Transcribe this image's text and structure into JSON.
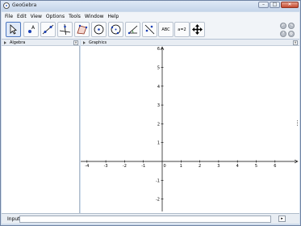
{
  "window": {
    "title": "GeoGebra",
    "minimize": "–",
    "maximize": "□",
    "close": "✕"
  },
  "menu": [
    "File",
    "Edit",
    "View",
    "Options",
    "Tools",
    "Window",
    "Help"
  ],
  "toolbar": {
    "tools": [
      {
        "name": "move-tool-button",
        "icon": "arrow-cursor-icon",
        "selected": true
      },
      {
        "name": "point-tool-button",
        "icon": "point-icon"
      },
      {
        "name": "line-tool-button",
        "icon": "line-through-two-points-icon"
      },
      {
        "name": "perpendicular-tool-button",
        "icon": "perpendicular-line-icon"
      },
      {
        "name": "polygon-tool-button",
        "icon": "polygon-icon"
      },
      {
        "name": "circle-tool-button",
        "icon": "circle-with-center-icon"
      },
      {
        "name": "ellipse-tool-button",
        "icon": "circle-through-points-icon"
      },
      {
        "name": "angle-tool-button",
        "icon": "angle-icon"
      },
      {
        "name": "reflect-tool-button",
        "icon": "reflect-icon"
      },
      {
        "name": "text-tool-button",
        "icon": "text-icon",
        "label": "ABC"
      },
      {
        "name": "slider-tool-button",
        "icon": "slider-icon",
        "label": "a=2"
      },
      {
        "name": "move-view-tool-button",
        "icon": "move-graphics-view-icon"
      }
    ],
    "undo": "↶",
    "redo": "↷",
    "help": "?",
    "settings": "⚙"
  },
  "panels": {
    "algebra": "Algebra",
    "graphics": "Graphics"
  },
  "graph": {
    "x_ticks": [
      "-4",
      "-3",
      "-2",
      "-1",
      "0",
      "1",
      "2",
      "3",
      "4",
      "5",
      "6"
    ],
    "y_ticks": [
      "6",
      "5",
      "4",
      "3",
      "2",
      "1",
      "-1",
      "-2"
    ],
    "origin_label": "0"
  },
  "input": {
    "label": "Input:",
    "value": "",
    "help": "▸"
  }
}
